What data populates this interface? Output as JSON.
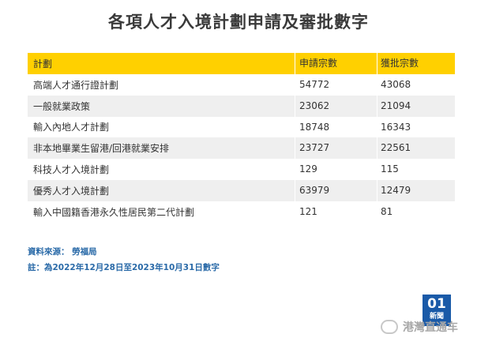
{
  "title": "各項人才入境計劃申請及審批數字",
  "table": {
    "headers": [
      "計劃",
      "申請宗數",
      "獲批宗數"
    ],
    "rows": [
      {
        "scheme": "高端人才通行證計劃",
        "applications": "54772",
        "approved": "43068"
      },
      {
        "scheme": "一般就業政策",
        "applications": "23062",
        "approved": "21094"
      },
      {
        "scheme": "輸入內地人才計劃",
        "applications": "18748",
        "approved": "16343"
      },
      {
        "scheme": "非本地畢業生留港/回港就業安排",
        "applications": "23727",
        "approved": "22561"
      },
      {
        "scheme": "科技人才入境計劃",
        "applications": "129",
        "approved": "115"
      },
      {
        "scheme": "優秀人才入境計劃",
        "applications": "63979",
        "approved": "12479"
      },
      {
        "scheme": "輸入中國籍香港永久性居民第二代計劃",
        "applications": "121",
        "approved": "81"
      }
    ]
  },
  "notes": {
    "source": "資料來源： 勞福局",
    "remark": "註：為2022年12月28日至2023年10月31日數字"
  },
  "logo": {
    "big": "01",
    "small": "新聞"
  },
  "watermark": "港灣直通车",
  "colors": {
    "header_bg": "#ffd000",
    "alt_row_bg": "#efefef",
    "note_text": "#2a6aa8",
    "logo_bg": "#1a5aa8"
  }
}
